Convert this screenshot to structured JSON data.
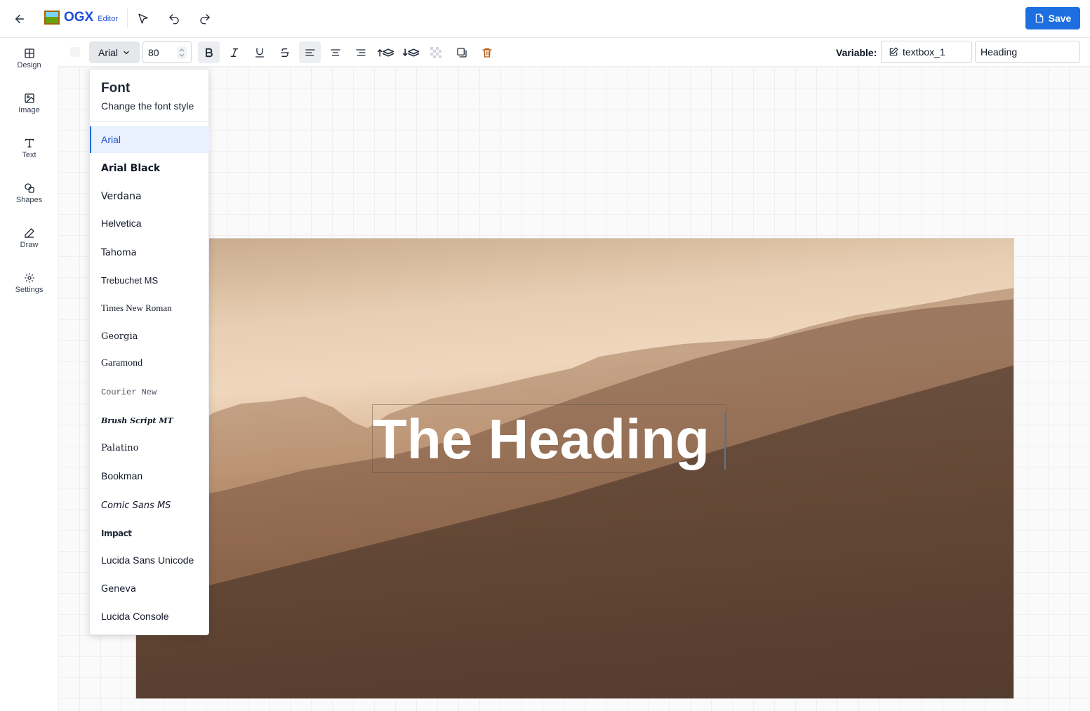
{
  "app": {
    "logo_text": "OGX",
    "logo_sub": "Editor",
    "save_label": "Save"
  },
  "sidebar": {
    "items": [
      {
        "label": "Design",
        "icon": "layout-icon"
      },
      {
        "label": "Image",
        "icon": "image-icon"
      },
      {
        "label": "Text",
        "icon": "text-icon"
      },
      {
        "label": "Shapes",
        "icon": "shapes-icon"
      },
      {
        "label": "Draw",
        "icon": "pencil-icon"
      },
      {
        "label": "Settings",
        "icon": "gear-icon"
      }
    ]
  },
  "toolbar": {
    "font_family": "Arial",
    "font_size": "80",
    "variable_label": "Variable:",
    "variable_name": "textbox_1",
    "variable_value": "Heading"
  },
  "canvas": {
    "heading_text": "The Heading"
  },
  "font_menu": {
    "title": "Font",
    "subtitle": "Change the font style",
    "selected": "Arial",
    "fonts": [
      "Arial",
      "Arial Black",
      "Verdana",
      "Helvetica",
      "Tahoma",
      "Trebuchet MS",
      "Times New Roman",
      "Georgia",
      "Garamond",
      "Courier New",
      "Brush Script MT",
      "Palatino",
      "Bookman",
      "Comic Sans MS",
      "Impact",
      "Lucida Sans Unicode",
      "Geneva",
      "Lucida Console"
    ]
  },
  "colors": {
    "accent": "#1d6fe0",
    "delete": "#b45309"
  }
}
